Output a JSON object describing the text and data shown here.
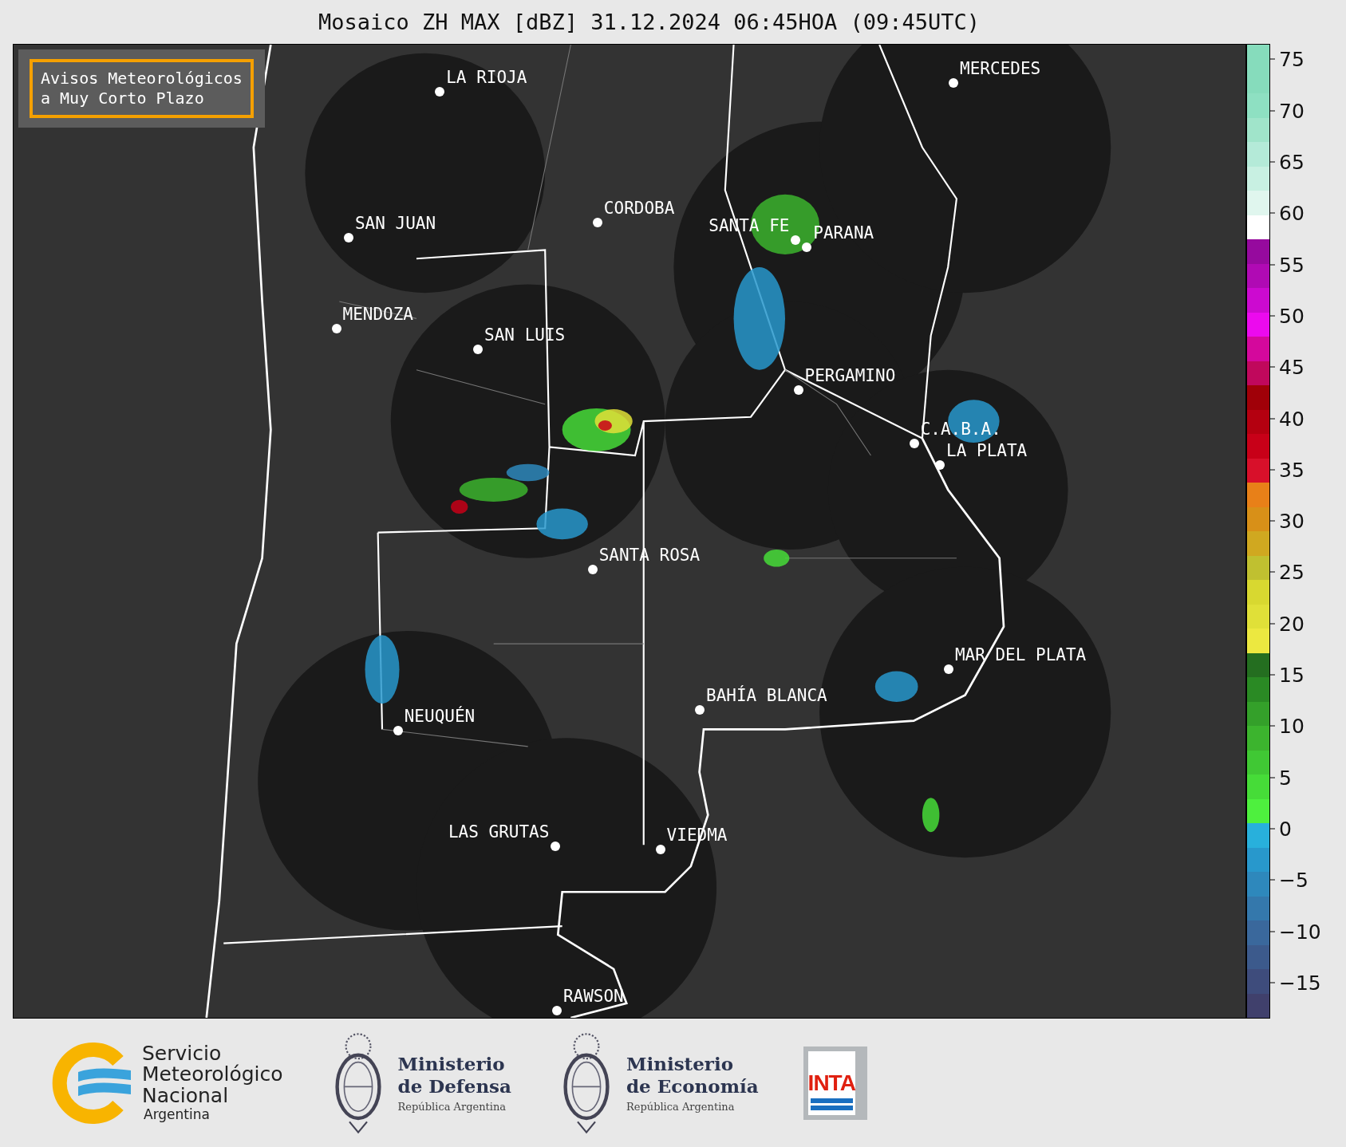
{
  "title": "Mosaico ZH MAX [dBZ] 31.12.2024 06:45HOA (09:45UTC)",
  "notice": [
    "Avisos Meteorológicos",
    "a Muy Corto Plazo"
  ],
  "cities": [
    {
      "name": "LA RIOJA"
    },
    {
      "name": "SAN JUAN"
    },
    {
      "name": "CORDOBA"
    },
    {
      "name": "SANTA FE"
    },
    {
      "name": "PARANA"
    },
    {
      "name": "MERCEDES"
    },
    {
      "name": "MENDOZA"
    },
    {
      "name": "SAN LUIS"
    },
    {
      "name": "PERGAMINO"
    },
    {
      "name": "C.A.B.A."
    },
    {
      "name": "LA PLATA"
    },
    {
      "name": "SANTA ROSA"
    },
    {
      "name": "MAR DEL PLATA"
    },
    {
      "name": "BAHÍA BLANCA"
    },
    {
      "name": "NEUQUÉN"
    },
    {
      "name": "LAS GRUTAS"
    },
    {
      "name": "VIEDMA"
    },
    {
      "name": "RAWSON"
    }
  ],
  "colorbar": {
    "ticks": [
      "75",
      "70",
      "65",
      "60",
      "55",
      "50",
      "45",
      "40",
      "35",
      "30",
      "25",
      "20",
      "15",
      "10",
      "5",
      "0",
      "−5",
      "−10",
      "−15"
    ],
    "bins": [
      {
        "color": "#86dcbc"
      },
      {
        "color": "#86dcbc"
      },
      {
        "color": "#8ee0c2"
      },
      {
        "color": "#a0e4ca"
      },
      {
        "color": "#b4ead8"
      },
      {
        "color": "#c8f0e2"
      },
      {
        "color": "#e0f6ee"
      },
      {
        "color": "#ffffff"
      },
      {
        "color": "#960a9e"
      },
      {
        "color": "#b00ab4"
      },
      {
        "color": "#cc0ad0"
      },
      {
        "color": "#ec0aee"
      },
      {
        "color": "#d4089c"
      },
      {
        "color": "#c0085c"
      },
      {
        "color": "#a00008"
      },
      {
        "color": "#b40010"
      },
      {
        "color": "#c80018"
      },
      {
        "color": "#d8102a"
      },
      {
        "color": "#e88018"
      },
      {
        "color": "#d89018"
      },
      {
        "color": "#d0a820"
      },
      {
        "color": "#c0c030"
      },
      {
        "color": "#d8d830"
      },
      {
        "color": "#e0e038"
      },
      {
        "color": "#ece840"
      },
      {
        "color": "#246e20"
      },
      {
        "color": "#2a8a24"
      },
      {
        "color": "#34a02a"
      },
      {
        "color": "#3cb42e"
      },
      {
        "color": "#40c834"
      },
      {
        "color": "#46dc38"
      },
      {
        "color": "#4ef03e"
      },
      {
        "color": "#28b0dc"
      },
      {
        "color": "#2898cc"
      },
      {
        "color": "#2e88bc"
      },
      {
        "color": "#3478ac"
      },
      {
        "color": "#3a689c"
      },
      {
        "color": "#3c5a8c"
      },
      {
        "color": "#3e4c7c"
      },
      {
        "color": "#40406c"
      }
    ]
  },
  "logos": [
    {
      "kind": "smn",
      "lines": [
        "Servicio",
        "Meteorológico",
        "Nacional"
      ],
      "subtitle": "Argentina"
    },
    {
      "kind": "ministry",
      "lines": [
        "Ministerio",
        "de Defensa"
      ],
      "subtitle": "República Argentina"
    },
    {
      "kind": "ministry",
      "lines": [
        "Ministerio",
        "de Economía"
      ],
      "subtitle": "República Argentina"
    },
    {
      "kind": "inta",
      "lines": [
        "INTA"
      ]
    }
  ]
}
